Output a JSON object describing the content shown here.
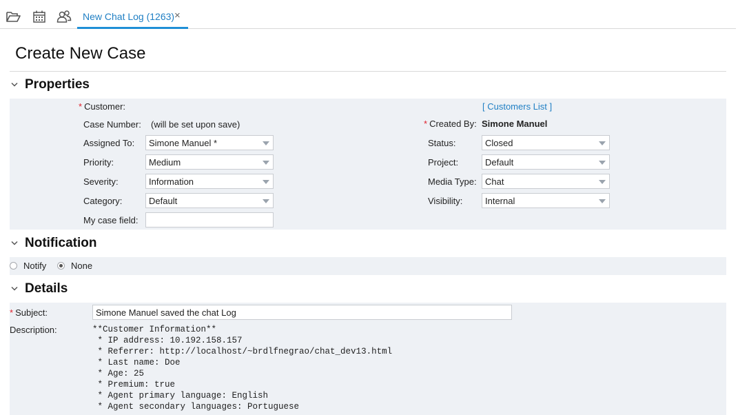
{
  "toolbar": {
    "icons": [
      "folder-open-icon",
      "calendar-icon",
      "users-icon"
    ],
    "active_tab": {
      "label": "New Chat Log (1263)",
      "close": "×"
    }
  },
  "page": {
    "title": "Create New Case"
  },
  "properties": {
    "section_title": "Properties",
    "customer_label": "Customer:",
    "customers_link": "[ Customers List ]",
    "case_number_label": "Case Number:",
    "case_number_value": "(will be set upon save)",
    "created_by_label": "Created By:",
    "created_by_value": "Simone Manuel",
    "assigned_to": {
      "label": "Assigned To:",
      "value": "Simone Manuel *"
    },
    "priority": {
      "label": "Priority:",
      "value": "Medium"
    },
    "severity": {
      "label": "Severity:",
      "value": "Information"
    },
    "category": {
      "label": "Category:",
      "value": "Default"
    },
    "my_case_field": {
      "label": "My case field:",
      "value": ""
    },
    "status": {
      "label": "Status:",
      "value": "Closed"
    },
    "project": {
      "label": "Project:",
      "value": "Default"
    },
    "media_type": {
      "label": "Media Type:",
      "value": "Chat"
    },
    "visibility": {
      "label": "Visibility:",
      "value": "Internal"
    }
  },
  "notification": {
    "section_title": "Notification",
    "notify_label": "Notify",
    "none_label": "None",
    "selected": "None"
  },
  "details": {
    "section_title": "Details",
    "subject_label": "Subject:",
    "subject_value": "Simone Manuel saved the chat Log",
    "description_label": "Description:",
    "description_lines": [
      "**Customer Information**",
      " * IP address: 10.192.158.157",
      " * Referrer: http://localhost/~brdlfnegrao/chat_dev13.html",
      " * Last name: Doe",
      " * Age: 25",
      " * Premium: true",
      " * Agent primary language: English",
      " * Agent secondary languages: Portuguese"
    ]
  },
  "colors": {
    "accent": "#1f8fd6",
    "link": "#1f7fc4",
    "required": "#e0202c",
    "panel_bg": "#eef1f5"
  }
}
